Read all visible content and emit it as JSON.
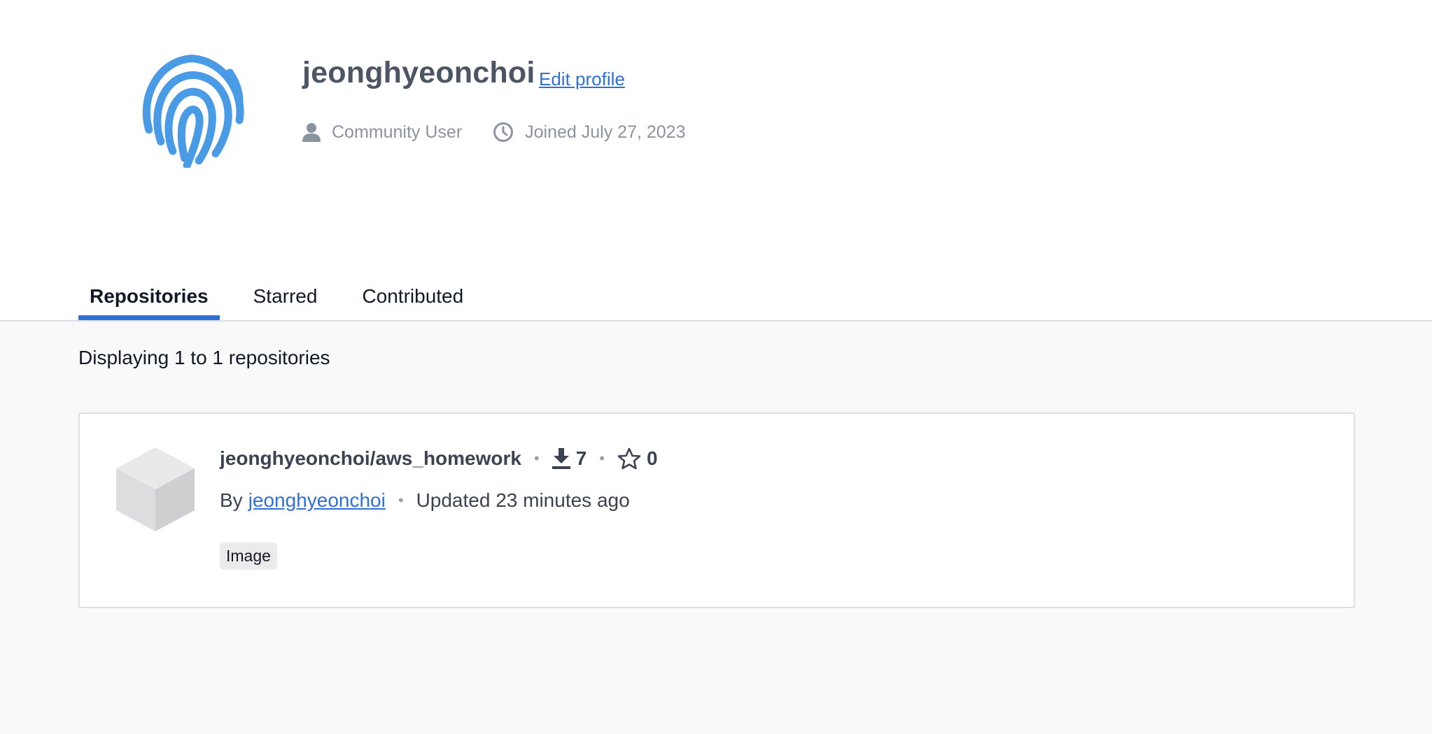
{
  "profile": {
    "username": "jeonghyeonchoi",
    "edit_label": "Edit profile",
    "user_type": "Community User",
    "joined": "Joined July 27, 2023",
    "avatar_icon": "fingerprint-icon",
    "accent_color": "#4a9be6"
  },
  "tabs": [
    {
      "label": "Repositories",
      "active": true
    },
    {
      "label": "Starred",
      "active": false
    },
    {
      "label": "Contributed",
      "active": false
    }
  ],
  "results": {
    "count_text": "Displaying 1 to 1 repositories"
  },
  "repositories": [
    {
      "name": "jeonghyeonchoi/aws_homework",
      "downloads": "7",
      "stars": "0",
      "by_label": "By",
      "owner": "jeonghyeonchoi",
      "updated": "Updated 23 minutes ago",
      "badge": "Image",
      "icon": "cube-icon"
    }
  ],
  "colors": {
    "link": "#2f6fd6",
    "tab_indicator": "#2f6fd6",
    "background": "#f9f9f9"
  }
}
